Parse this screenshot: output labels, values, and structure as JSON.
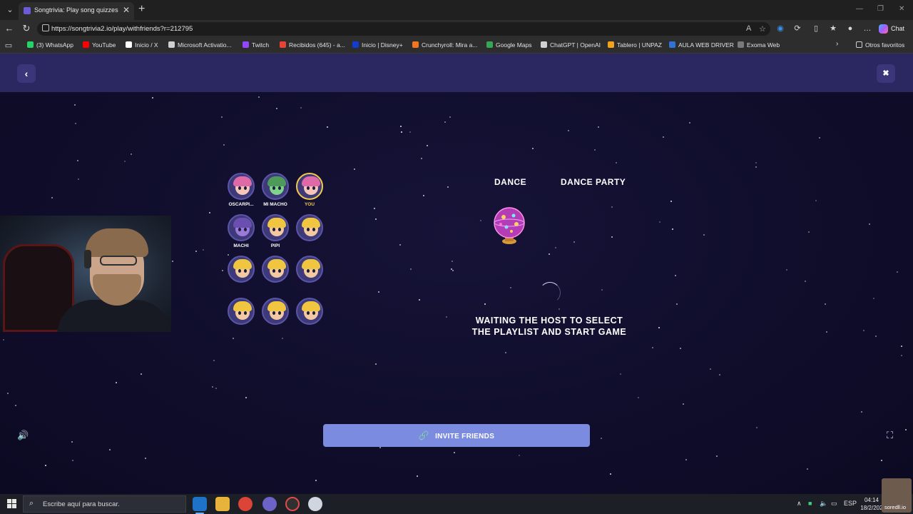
{
  "browser": {
    "tab_title": "Songtrivia: Play song quizzes with",
    "url": "https://songtrivia2.io/play/withfriends?r=212795",
    "chat_label": "Chat",
    "bookmarks": [
      {
        "label": "(3) WhatsApp",
        "color": "#25d366"
      },
      {
        "label": "YouTube",
        "color": "#ff0000"
      },
      {
        "label": "Inicio / X",
        "color": "#ffffff"
      },
      {
        "label": "Microsoft Activatio...",
        "color": "#cfcfcf"
      },
      {
        "label": "Twitch",
        "color": "#9146ff"
      },
      {
        "label": "Recibidos (645) - a...",
        "color": "#ea4335"
      },
      {
        "label": "Inicio | Disney+",
        "color": "#113ccf"
      },
      {
        "label": "Crunchyroll: Mira a...",
        "color": "#f47521"
      },
      {
        "label": "Google Maps",
        "color": "#34a853"
      },
      {
        "label": "ChatGPT | OpenAI",
        "color": "#d0d0d0"
      },
      {
        "label": "Tablero | UNPAZ",
        "color": "#f4a11b"
      },
      {
        "label": "AULA WEB DRIVER",
        "color": "#2f73d8"
      },
      {
        "label": "Exoma Web",
        "color": "#7a7a7a"
      }
    ],
    "other_favorites": "Otros favoritos"
  },
  "lobby": {
    "players": [
      {
        "name": "OSCARPI...",
        "avatar": "pink-girl",
        "you": false
      },
      {
        "name": "MI MACHO",
        "avatar": "green-alien",
        "you": false
      },
      {
        "name": "YOU",
        "avatar": "pink-girl",
        "you": true
      },
      {
        "name": "MACHI",
        "avatar": "purple-monster",
        "you": false
      },
      {
        "name": "PIPI",
        "avatar": "blond-kid",
        "you": false
      },
      {
        "name": "",
        "avatar": "blond-kid",
        "you": false
      },
      {
        "name": "",
        "avatar": "blond-kid",
        "you": false
      },
      {
        "name": "",
        "avatar": "blond-kid",
        "you": false
      },
      {
        "name": "",
        "avatar": "blond-kid",
        "you": false
      },
      {
        "name": "",
        "avatar": "blond-kid",
        "you": false
      },
      {
        "name": "",
        "avatar": "blond-kid",
        "you": false
      },
      {
        "name": "",
        "avatar": "blond-kid",
        "you": false
      }
    ],
    "genre": "DANCE",
    "playlist": "DANCE PARTY",
    "waiting_line1": "WAITING THE HOST TO SELECT",
    "waiting_line2": "THE PLAYLIST AND START GAME",
    "invite_label": "INVITE FRIENDS"
  },
  "taskbar": {
    "search_placeholder": "Escribe aquí para buscar.",
    "language": "ESP",
    "time": "04:14",
    "date": "18/2/202",
    "watermark": "soredll.io"
  },
  "colors": {
    "accent": "#7b8be0",
    "header": "#2b2761",
    "background": "#0f0d2a",
    "you_highlight": "#f2c94c"
  }
}
